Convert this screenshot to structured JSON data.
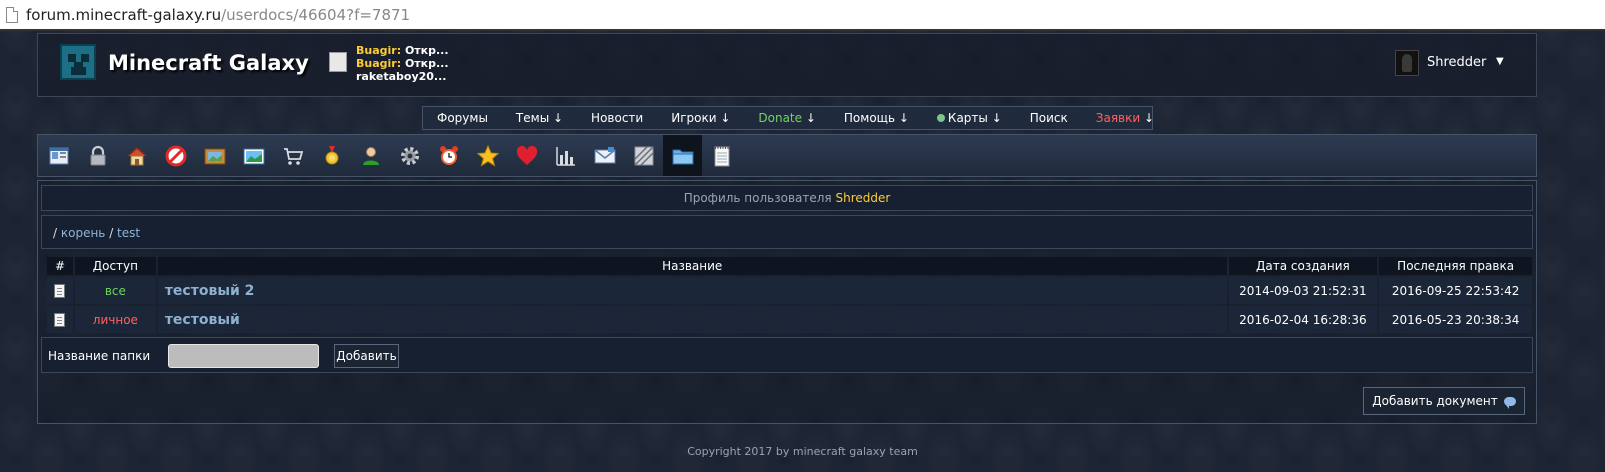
{
  "browser": {
    "url_host": "forum.minecraft-galaxy.ru",
    "url_path": "/userdocs/46604?f=7871"
  },
  "header": {
    "site_title": "Minecraft Galaxy",
    "activity": [
      {
        "name": "Buagir:",
        "text": " Откр..."
      },
      {
        "name": "Buagir:",
        "text": " Откр..."
      },
      {
        "name": "",
        "text": "raketaboy20..."
      }
    ],
    "user_name": "Shredder",
    "user_caret": "▼"
  },
  "nav": {
    "items": [
      {
        "label": "Форумы",
        "arrow": "",
        "color": "#ffffff"
      },
      {
        "label": "Темы",
        "arrow": " ↓",
        "color": "#ffffff"
      },
      {
        "label": "Новости",
        "arrow": "",
        "color": "#ffffff"
      },
      {
        "label": "Игроки",
        "arrow": " ↓",
        "color": "#ffffff"
      },
      {
        "label": "Donate",
        "arrow": " ↓",
        "color": "#6fd45f"
      },
      {
        "label": "Помощь",
        "arrow": " ↓",
        "color": "#ffffff"
      },
      {
        "label": "Карты",
        "arrow": " ↓",
        "color": "#ffffff"
      },
      {
        "label": "Поиск",
        "arrow": "",
        "color": "#ffffff"
      },
      {
        "label": "Заявки",
        "arrow": " ↓",
        "color": "#ff6060"
      }
    ]
  },
  "toolbar": {
    "icons": [
      "contact-card-icon",
      "lock-icon",
      "home-icon",
      "ban-icon",
      "picture-frame-icon",
      "landscape-icon",
      "cart-icon",
      "medal-icon",
      "user-icon",
      "gear-icon",
      "alarm-clock-icon",
      "star-icon",
      "heart-icon",
      "bar-chart-icon",
      "envelope-icon",
      "texture-icon",
      "folder-icon",
      "notepad-icon"
    ],
    "active_icon": "folder-icon"
  },
  "profile": {
    "prefix": "Профиль пользователя ",
    "user": "Shredder"
  },
  "breadcrumb": {
    "sep1": "/ ",
    "root": "корень",
    "sep2": " / ",
    "current": "test"
  },
  "table": {
    "headers": {
      "num": "#",
      "access": "Доступ",
      "title": "Название",
      "created": "Дата создания",
      "modified": "Последняя правка"
    },
    "rows": [
      {
        "access": "все",
        "access_type": "public",
        "title": "тестовый 2",
        "created": "2014-09-03 21:52:31",
        "modified": "2016-09-25 22:53:42"
      },
      {
        "access": "личное",
        "access_type": "private",
        "title": "тестовый",
        "created": "2016-02-04 16:28:36",
        "modified": "2016-05-23 20:38:34"
      }
    ]
  },
  "folder_form": {
    "label": "Название папки",
    "input_value": "",
    "button": "Добавить"
  },
  "add_document": "Добавить документ",
  "footer": "Copyright 2017 by minecraft galaxy team"
}
